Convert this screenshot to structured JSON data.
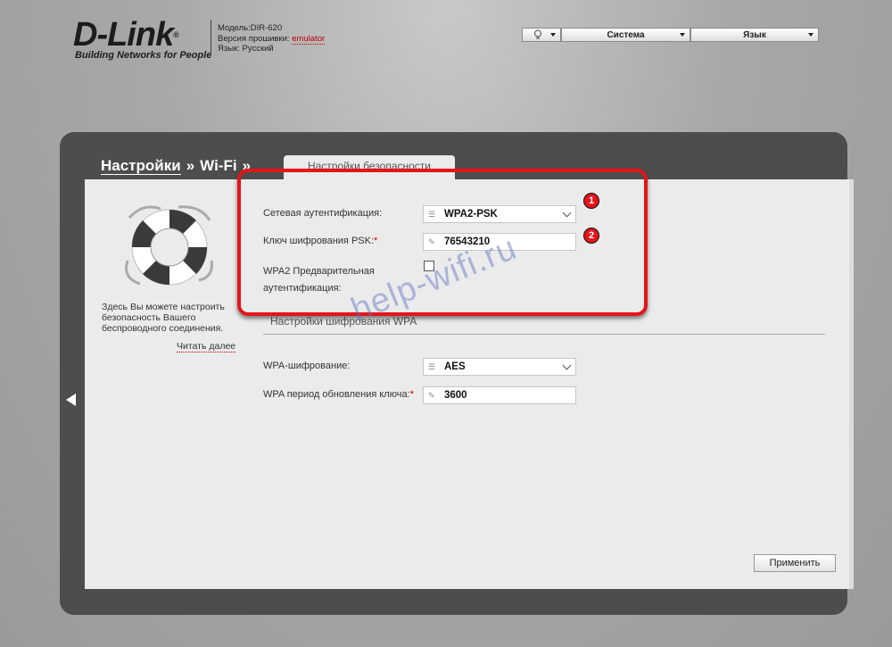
{
  "header": {
    "logo_text": "D-Link",
    "logo_reg": "®",
    "logo_tagline": "Building Networks for People",
    "model": "Модель:DIR-620",
    "firmware_label": "Версия прошивки:",
    "firmware_value": "emulator",
    "language_info": "Язык: Русский"
  },
  "topbar": {
    "menu_system": "Система",
    "menu_language": "Язык"
  },
  "breadcrumb": {
    "item1": "Настройки",
    "sep1": "»",
    "item2": "Wi-Fi",
    "sep2": "»",
    "active_tab": "Настройки безопасности"
  },
  "sidebar": {
    "help_text": "Здесь Вы можете настроить безопасность Вашего беспроводного соединения.",
    "read_more": "Читать далее"
  },
  "form": {
    "auth_label": "Сетевая аутентификация:",
    "auth_value": "WPA2-PSK",
    "psk_label": "Ключ шифрования PSK:",
    "psk_required": "*",
    "psk_value": "76543210",
    "preauth_label_line1": "WPA2 Предварительная",
    "preauth_label_line2": "аутентификация:",
    "preauth_checked": false,
    "section_title": "Настройки шифрования WPA",
    "wpa_enc_label": "WPA-шифрование:",
    "wpa_enc_value": "AES",
    "rekey_label": "WPA период обновления ключа:",
    "rekey_required": "*",
    "rekey_value": "3600"
  },
  "buttons": {
    "apply": "Применить"
  },
  "annotations": {
    "badge1": "1",
    "badge2": "2",
    "watermark": "help-wifi.ru",
    "accent_color": "#e3151a"
  }
}
